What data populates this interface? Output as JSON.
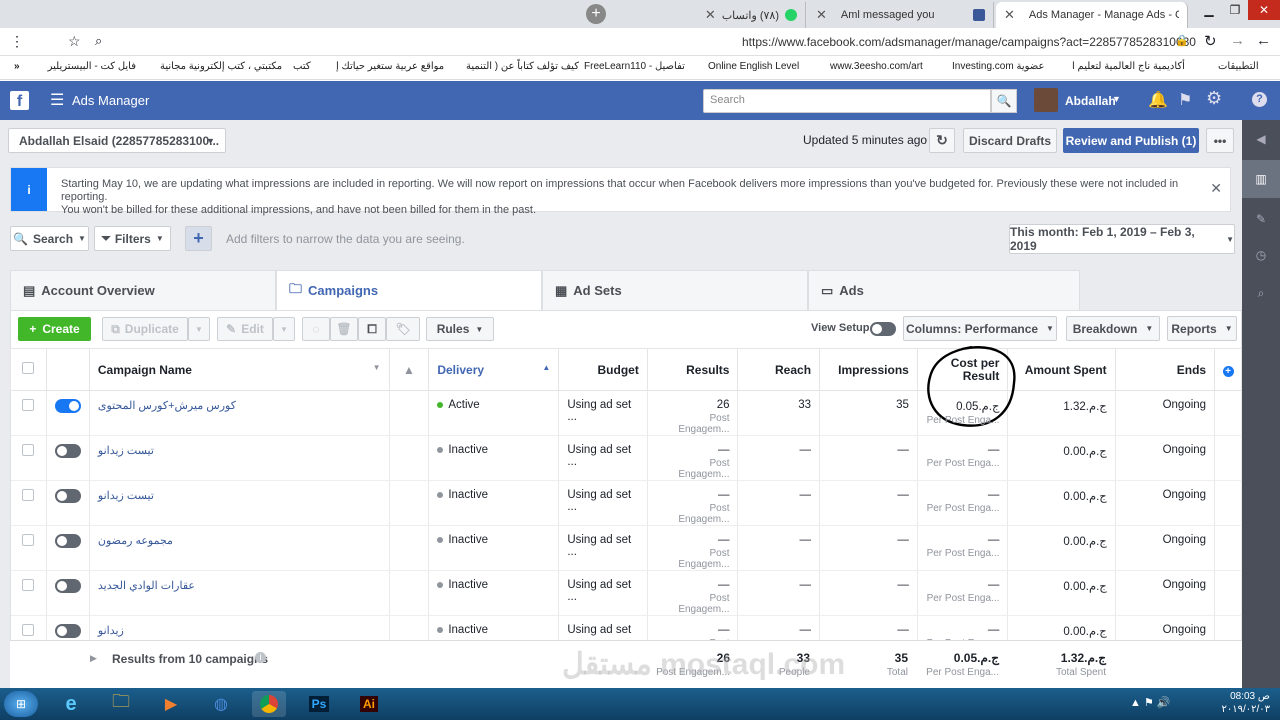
{
  "browser": {
    "tabs": [
      {
        "label": "(٧٨) واتساب"
      },
      {
        "label": "Aml messaged you"
      },
      {
        "label": "Ads Manager - Manage Ads - Ca"
      }
    ],
    "url": "https://www.facebook.com/adsmanager/manage/campaigns?act=2285778528310030",
    "bookmarks": [
      "التطبيقات",
      "أكاديمية ناج العالمية لتعليم ا",
      "Investing.com عضوية",
      "www.3eesho.com/art",
      "Online English Level",
      "FreeLearn110 - تفاصيل",
      "كيف تؤلف كتاباً عن ( التنمية",
      "مواقع عربية ستغير حياتك إ",
      "كتب",
      "مكتبتي ، كتب إلكترونية مجانية",
      "فايل كت - البيستريلير - الـ"
    ]
  },
  "fb": {
    "app_title": "Ads Manager",
    "search_placeholder": "Search",
    "user_name": "Abdallah"
  },
  "toolbar": {
    "account": "Abdallah Elsaid (22857785283100...",
    "updated": "Updated 5 minutes ago",
    "discard": "Discard Drafts",
    "review": "Review and Publish (1)"
  },
  "notice": {
    "text1": "Starting May 10, we are updating what impressions are included in reporting. We will now report on impressions that occur when Facebook delivers more impressions than you've budgeted for. Previously these were not included in reporting.",
    "text2": "You won't be billed for these additional impressions, and have not been billed for them in the past."
  },
  "filters": {
    "search": "Search",
    "filters": "Filters",
    "hint": "Add filters to narrow the data you are seeing.",
    "date": "This month: Feb 1, 2019 – Feb 3, 2019"
  },
  "tabs": {
    "overview": "Account Overview",
    "campaigns": "Campaigns",
    "adsets": "Ad Sets",
    "ads": "Ads"
  },
  "actions": {
    "create": "Create",
    "duplicate": "Duplicate",
    "edit": "Edit",
    "rules": "Rules",
    "view_setup": "View Setup",
    "columns": "Columns: Performance",
    "breakdown": "Breakdown",
    "reports": "Reports"
  },
  "table": {
    "headers": {
      "name": "Campaign Name",
      "delivery": "Delivery",
      "budget": "Budget",
      "results": "Results",
      "reach": "Reach",
      "impressions": "Impressions",
      "cpr1": "Cost per",
      "cpr2": "Result",
      "spent": "Amount Spent",
      "ends": "Ends"
    },
    "rows": [
      {
        "name": "كورس ميرش+كورس المحتوى",
        "delivery": "Active",
        "budget": "Using ad set ...",
        "results": "26",
        "results_sub": "Post Engagem...",
        "reach": "33",
        "impressions": "35",
        "cpr": "ج.م.0.05",
        "cpr_sub": "Per Post Enga...",
        "spent": "ج.م.1.32",
        "ends": "Ongoing",
        "on": true
      },
      {
        "name": "تيست زيدانو",
        "delivery": "Inactive",
        "budget": "Using ad set ...",
        "results": "—",
        "results_sub": "Post Engagem...",
        "reach": "—",
        "impressions": "—",
        "cpr": "—",
        "cpr_sub": "Per Post Enga...",
        "spent": "ج.م.0.00",
        "ends": "Ongoing",
        "on": false
      },
      {
        "name": "تيست زيدانو",
        "delivery": "Inactive",
        "budget": "Using ad set ...",
        "results": "—",
        "results_sub": "Post Engagem...",
        "reach": "—",
        "impressions": "—",
        "cpr": "—",
        "cpr_sub": "Per Post Enga...",
        "spent": "ج.م.0.00",
        "ends": "Ongoing",
        "on": false
      },
      {
        "name": "مجموعه رمضون",
        "delivery": "Inactive",
        "budget": "Using ad set ...",
        "results": "—",
        "results_sub": "Post Engagem...",
        "reach": "—",
        "impressions": "—",
        "cpr": "—",
        "cpr_sub": "Per Post Enga...",
        "spent": "ج.م.0.00",
        "ends": "Ongoing",
        "on": false
      },
      {
        "name": "عقارات الوادي الجديد",
        "delivery": "Inactive",
        "budget": "Using ad set ...",
        "results": "—",
        "results_sub": "Post Engagem...",
        "reach": "—",
        "impressions": "—",
        "cpr": "—",
        "cpr_sub": "Per Post Enga...",
        "spent": "ج.م.0.00",
        "ends": "Ongoing",
        "on": false
      },
      {
        "name": "زيدانو",
        "delivery": "Inactive",
        "budget": "Using ad set ...",
        "results": "—",
        "results_sub": "Post Engagem...",
        "reach": "—",
        "impressions": "—",
        "cpr": "—",
        "cpr_sub": "Per Post Enga...",
        "spent": "ج.م.0.00",
        "ends": "Ongoing",
        "on": false
      }
    ],
    "footer": {
      "label": "Results from 10 campaigns",
      "results": "26",
      "results_sub": "Post Engagem...",
      "reach": "33",
      "reach_sub": "People",
      "impressions": "35",
      "impressions_sub": "Total",
      "cpr": "ج.م.0.05",
      "cpr_sub": "Per Post Enga...",
      "spent": "ج.م.1.32",
      "spent_sub": "Total Spent"
    }
  },
  "watermark": "مستقل mostaql.com",
  "taskbar": {
    "time": "08:03 ص",
    "date": "٢٠١٩/٠٢/٠٣"
  }
}
